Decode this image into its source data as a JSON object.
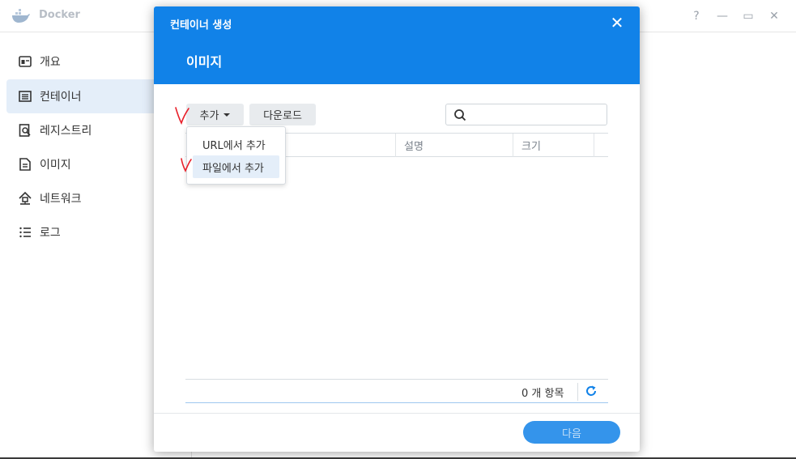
{
  "app": {
    "title": "Docker",
    "controls": {
      "help": "?",
      "minimize": "—",
      "maximize": "▭",
      "close": "✕"
    }
  },
  "sidebar": {
    "items": [
      {
        "label": "개요",
        "icon": "overview-icon",
        "active": false
      },
      {
        "label": "컨테이너",
        "icon": "container-icon",
        "active": true
      },
      {
        "label": "레지스트리",
        "icon": "registry-icon",
        "active": false
      },
      {
        "label": "이미지",
        "icon": "image-icon",
        "active": false
      },
      {
        "label": "네트워크",
        "icon": "network-icon",
        "active": false
      },
      {
        "label": "로그",
        "icon": "log-icon",
        "active": false
      }
    ]
  },
  "modal": {
    "title": "컨테이너 생성",
    "close": "✕",
    "subtitle": "이미지",
    "toolbar": {
      "add_label": "추가",
      "download_label": "다운로드",
      "search_value": "",
      "search_placeholder": ""
    },
    "dropdown": {
      "items": [
        {
          "label": "URL에서 추가",
          "hover": false
        },
        {
          "label": "파일에서 추가",
          "hover": true
        }
      ]
    },
    "grid": {
      "columns": [
        "",
        "설명",
        "크기",
        ""
      ],
      "rows": []
    },
    "footer": {
      "count_text": "0 개 항목"
    },
    "next_label": "다음"
  },
  "colors": {
    "accent": "#1182e8",
    "active_bg": "#e4eef9",
    "annotation": "#e8202a"
  }
}
